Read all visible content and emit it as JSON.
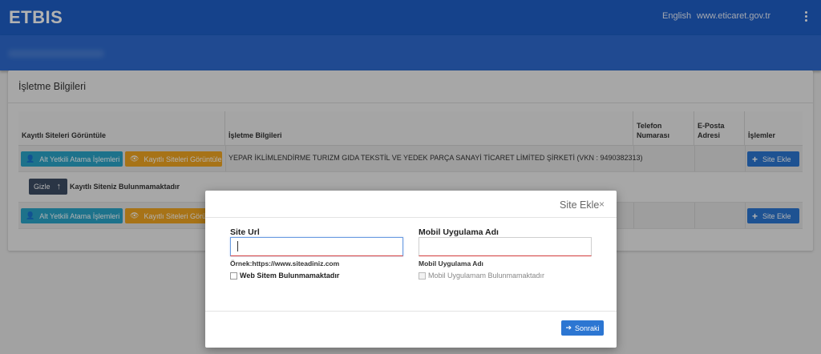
{
  "app": {
    "title": "ETBIS"
  },
  "topbar": {
    "language_label": "English",
    "site_link": "www.eticaret.gov.tr",
    "menu_icon": "more-vertical-icon"
  },
  "card": {
    "title": "İşletme Bilgileri",
    "table": {
      "headers": {
        "col1": "Kayıtlı Siteleri Görüntüle",
        "col2": "İşletme Bilgileri",
        "col3": "Telefon Numarası",
        "col4": "E-Posta Adresi",
        "col5": "İşlemler"
      },
      "row1": {
        "sub_authority_button": "Alt Yetkili Atama İşlemleri",
        "view_sites_button": "Kayıtlı Siteleri Görüntüle",
        "company_info": "YEPAR İKLİMLENDİRME TURIZM GIDA TEKSTİL VE YEDEK PARÇA SANAYİ TİCARET LİMİTED ŞİRKETİ (VKN : 9490382313)",
        "add_site_button": "Site Ekle"
      },
      "row2": {
        "hide_button": "Gizle",
        "message": "Kayıtlı Siteniz Bulunmamaktadır"
      },
      "row3": {
        "sub_authority_button": "Alt Yetkili Atama İşlemleri",
        "view_sites_button": "Kayıtlı Siteleri Görüntüle",
        "add_site_button": "Site Ekle"
      }
    }
  },
  "modal": {
    "title": "Site Ekle",
    "close_symbol": "×",
    "site_url": {
      "label": "Site Url",
      "value": "",
      "hint": "Örnek:https://www.siteadiniz.com",
      "checkbox_label": "Web Sitem Bulunmamaktadır",
      "checked": false
    },
    "mobile_app": {
      "label": "Mobil Uygulama Adı",
      "value": "",
      "hint": "Mobil Uygulama Adı",
      "checkbox_label": "Mobil Uygulamam Bulunmamaktadır",
      "checked": false
    },
    "next_button": "Sonraki"
  }
}
